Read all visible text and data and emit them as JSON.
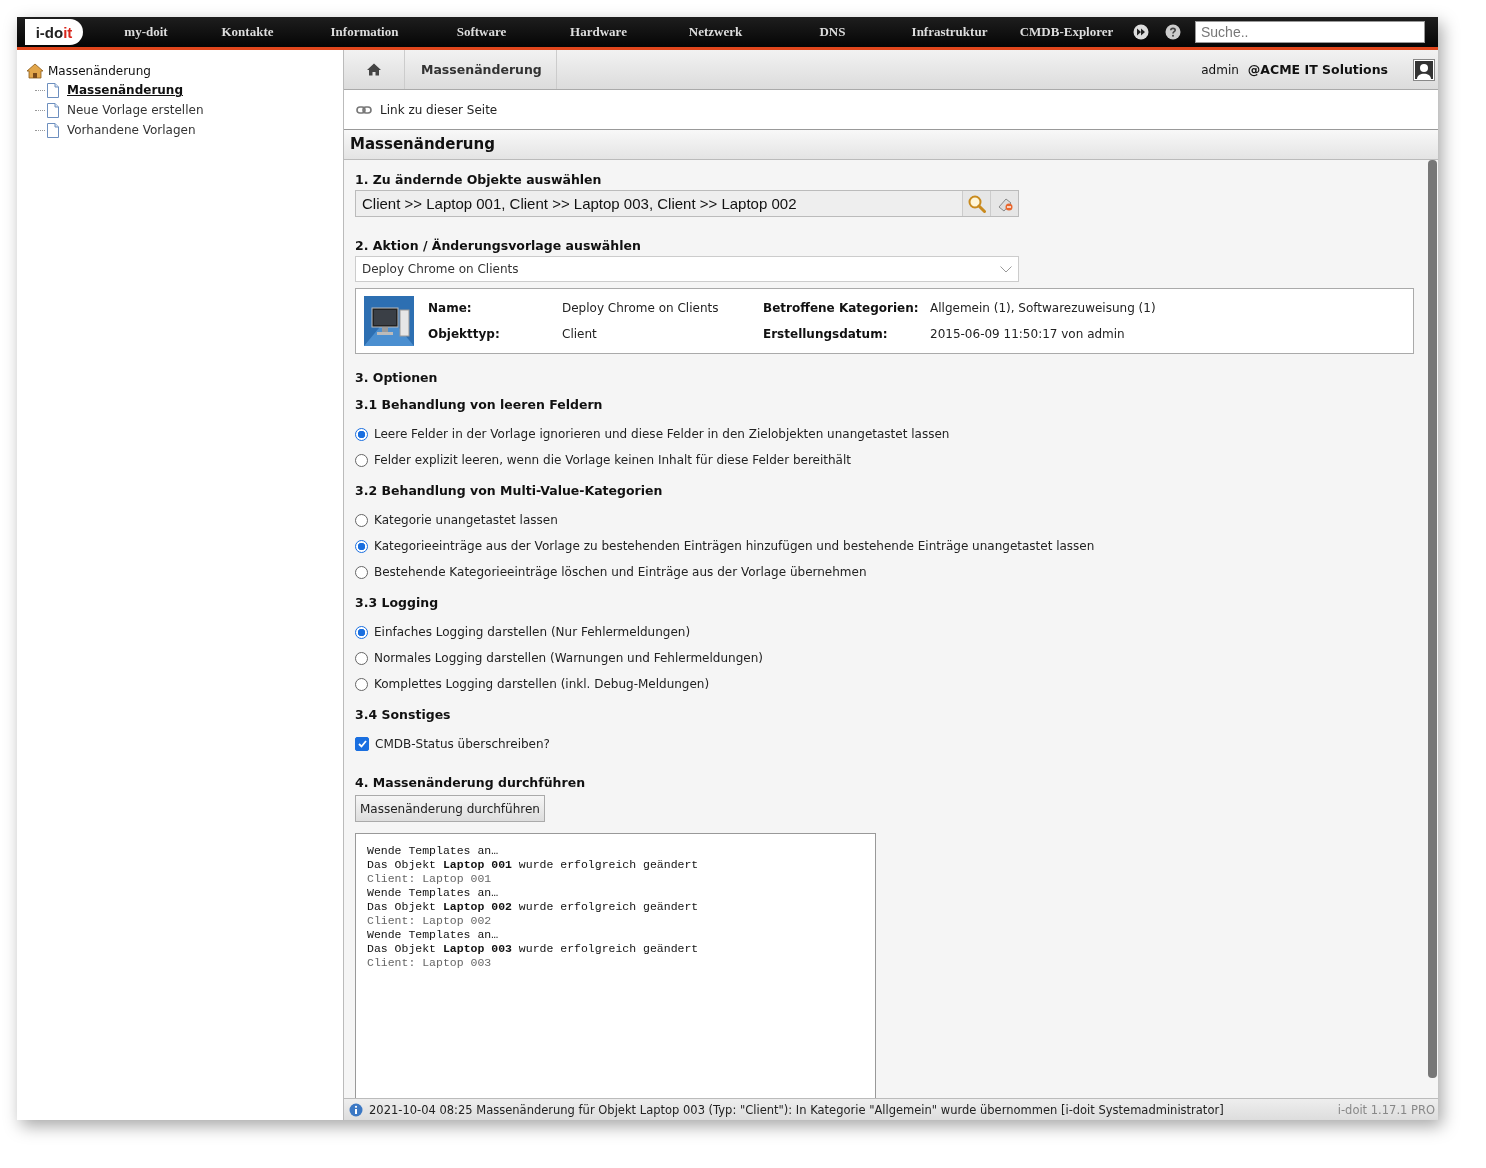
{
  "nav": {
    "logo": [
      {
        "text": "i-do",
        "kind": "plain"
      },
      {
        "text": "it",
        "kind": "accent"
      }
    ],
    "items": [
      "my-doit",
      "Kontakte",
      "Information",
      "Software",
      "Hardware",
      "Netzwerk",
      "DNS",
      "Infrastruktur",
      "CMDB-Explorer"
    ],
    "search": {
      "placeholder": "Suche.."
    }
  },
  "sidebar": {
    "root": "Massenänderung",
    "children": [
      {
        "label": "Massenänderung",
        "selected": true
      },
      {
        "label": "Neue Vorlage erstellen",
        "selected": false
      },
      {
        "label": "Vorhandene Vorlagen",
        "selected": false
      }
    ]
  },
  "breadcrumb": {
    "items": [
      "Massenänderung"
    ],
    "user": "admin",
    "tenant": "@ACME IT Solutions"
  },
  "link": "Link zu dieser Seite",
  "page_title": "Massenänderung",
  "step1": {
    "heading": "1. Zu ändernde Objekte auswählen",
    "value": "Client >> Laptop 001, Client >> Laptop 003, Client >> Laptop 002"
  },
  "step2": {
    "heading": "2. Aktion / Änderungsvorlage auswählen",
    "select": "Deploy Chrome on Clients",
    "details": [
      {
        "label": "Name:",
        "value": "Deploy Chrome on Clients"
      },
      {
        "label": "Betroffene Kategorien:",
        "value": "Allgemein (1), Softwarezuweisung (1)"
      },
      {
        "label": "Objekttyp:",
        "value": "Client"
      },
      {
        "label": "Erstellungsdatum:",
        "value": "2015-06-09 11:50:17 von admin"
      }
    ]
  },
  "options": {
    "heading": "3. Optionen",
    "groups": [
      {
        "heading": "3.1 Behandlung von leeren Feldern",
        "kind": "radio",
        "options": [
          {
            "label": "Leere Felder in der Vorlage ignorieren und diese Felder in den Zielobjekten unangetastet lassen",
            "selected": true
          },
          {
            "label": "Felder explizit leeren, wenn die Vorlage keinen Inhalt für diese Felder bereithält",
            "selected": false
          }
        ]
      },
      {
        "heading": "3.2 Behandlung von Multi-Value-Kategorien",
        "kind": "radio",
        "options": [
          {
            "label": "Kategorie unangetastet lassen",
            "selected": false
          },
          {
            "label": "Kategorieeinträge aus der Vorlage zu bestehenden Einträgen hinzufügen und bestehende Einträge unangetastet lassen",
            "selected": true
          },
          {
            "label": "Bestehende Kategorieeinträge löschen und Einträge aus der Vorlage übernehmen",
            "selected": false
          }
        ]
      },
      {
        "heading": "3.3 Logging",
        "kind": "radio",
        "options": [
          {
            "label": "Einfaches Logging darstellen (Nur Fehlermeldungen)",
            "selected": true
          },
          {
            "label": "Normales Logging darstellen (Warnungen und Fehlermeldungen)",
            "selected": false
          },
          {
            "label": "Komplettes Logging darstellen (inkl. Debug-Meldungen)",
            "selected": false
          }
        ]
      },
      {
        "heading": "3.4 Sonstiges",
        "kind": "checkbox",
        "options": [
          {
            "label": "CMDB-Status überschreiben?",
            "checked": true
          }
        ]
      }
    ]
  },
  "step4": {
    "heading": "4. Massenänderung durchführen",
    "button": "Massenänderung durchführen",
    "log": [
      {
        "kind": "info",
        "text": "Wende Templates an…"
      },
      {
        "kind": "info",
        "text": "Das Objekt **Laptop 001** wurde erfolgreich geändert"
      },
      {
        "kind": "detail",
        "text": "Client: Laptop 001"
      },
      {
        "kind": "info",
        "text": "Wende Templates an…"
      },
      {
        "kind": "info",
        "text": "Das Objekt **Laptop 002** wurde erfolgreich geändert"
      },
      {
        "kind": "detail",
        "text": "Client: Laptop 002"
      },
      {
        "kind": "info",
        "text": "Wende Templates an…"
      },
      {
        "kind": "info",
        "text": "Das Objekt **Laptop 003** wurde erfolgreich geändert"
      },
      {
        "kind": "detail",
        "text": "Client: Laptop 003"
      }
    ]
  },
  "status_bar": {
    "message": "2021-10-04 08:25 Massenänderung für Objekt Laptop 003 (Typ: \"Client\"): In Kategorie \"Allgemein\" wurde übernommen [i-doit Systemadministrator]",
    "version": "i-doit 1.17.1 PRO"
  }
}
